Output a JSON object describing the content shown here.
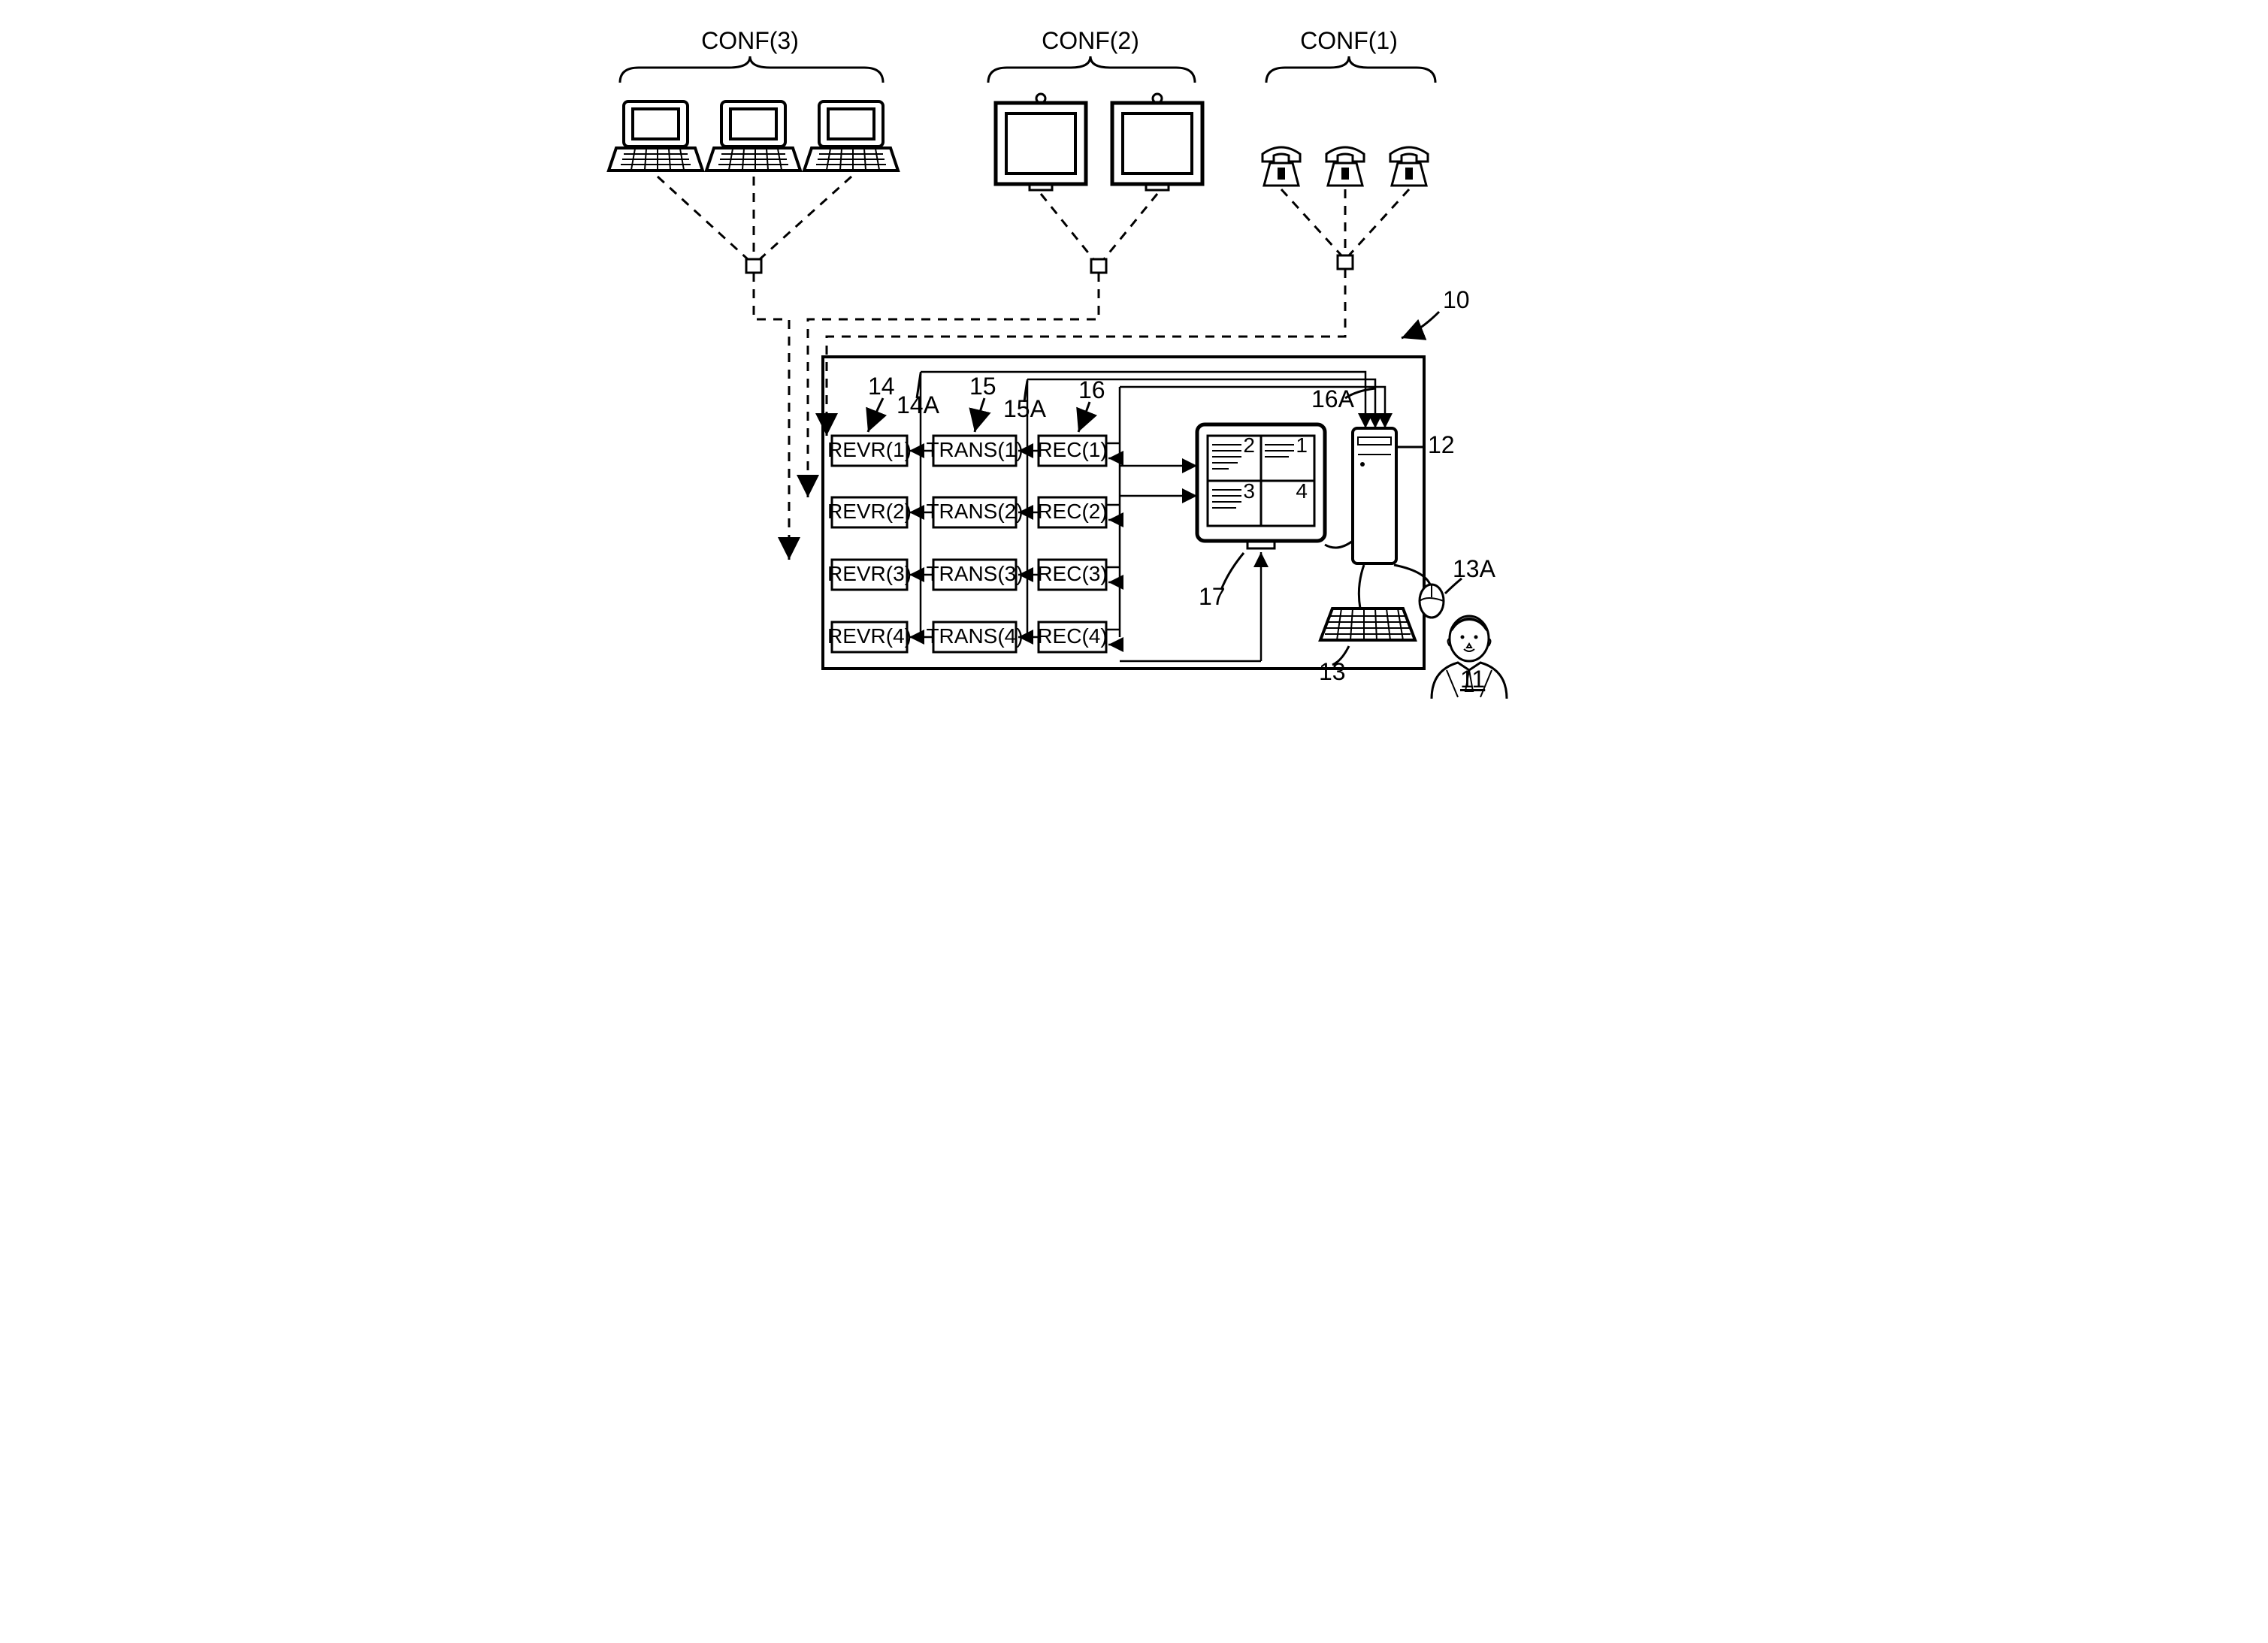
{
  "conf": {
    "c1": "CONF(1)",
    "c2": "CONF(2)",
    "c3": "CONF(3)"
  },
  "revr": [
    "REVR(1)",
    "REVR(2)",
    "REVR(3)",
    "REVR(4)"
  ],
  "trans": [
    "TRANS(1)",
    "TRANS(2)",
    "TRANS(3)",
    "TRANS(4)"
  ],
  "rec": [
    "REC(1)",
    "REC(2)",
    "REC(3)",
    "REC(4)"
  ],
  "refs": {
    "r10": "10",
    "r11": "11",
    "r12": "12",
    "r13": "13",
    "r13A": "13A",
    "r14": "14",
    "r14A": "14A",
    "r15": "15",
    "r15A": "15A",
    "r16": "16",
    "r16A": "16A",
    "r17": "17"
  },
  "quad": {
    "q1": "1",
    "q2": "2",
    "q3": "3",
    "q4": "4"
  }
}
